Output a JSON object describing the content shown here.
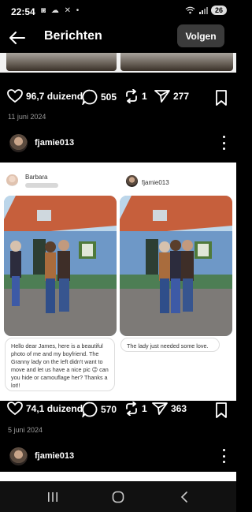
{
  "status_bar": {
    "time": "22:54",
    "left_icons": "◙ ☁ ✕ •",
    "battery": "26"
  },
  "header": {
    "title": "Berichten",
    "follow_label": "Volgen"
  },
  "posts": [
    {
      "likes": "96,7 duizend",
      "comments": "505",
      "reposts": "1",
      "shares": "277",
      "date": "11 juni 2024",
      "author": "fjamie013"
    },
    {
      "likes": "74,1 duizend",
      "comments": "570",
      "reposts": "1",
      "shares": "363",
      "date": "5 juni 2024",
      "author": "fjamie013"
    }
  ],
  "post_image": {
    "left_card": {
      "name": "Barbara",
      "message": "Hello dear James, here is a beautiful photo of me and my boyfriend. The Granny lady on the left didn't want to move and let us have a nice pic 😉 can you hide or camouflage her? Thanks a lot!!"
    },
    "right_card": {
      "name": "fjamie013",
      "message": "The lady just needed some love."
    }
  },
  "icons": [
    "back-arrow-icon",
    "heart-icon",
    "comment-icon",
    "repost-icon",
    "share-icon",
    "bookmark-icon",
    "more-icon"
  ],
  "colors": {
    "background": "#000000",
    "follow_button": "#3b3b3b",
    "date_text": "#9a9a9a"
  }
}
